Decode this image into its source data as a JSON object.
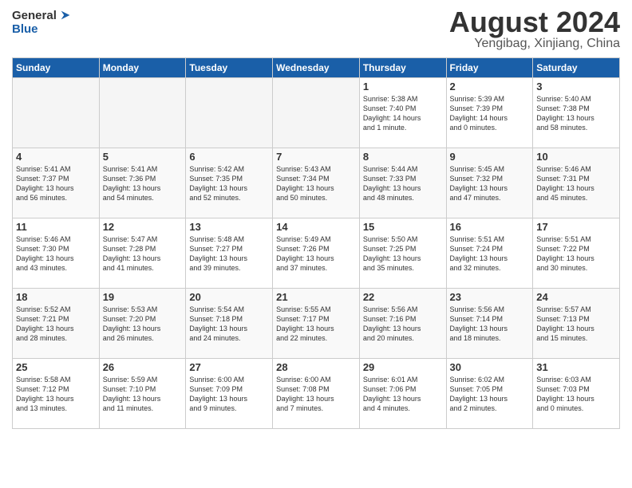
{
  "header": {
    "logo_line1": "General",
    "logo_line2": "Blue",
    "month_title": "August 2024",
    "location": "Yengibag, Xinjiang, China"
  },
  "weekdays": [
    "Sunday",
    "Monday",
    "Tuesday",
    "Wednesday",
    "Thursday",
    "Friday",
    "Saturday"
  ],
  "weeks": [
    [
      {
        "day": "",
        "info": ""
      },
      {
        "day": "",
        "info": ""
      },
      {
        "day": "",
        "info": ""
      },
      {
        "day": "",
        "info": ""
      },
      {
        "day": "1",
        "info": "Sunrise: 5:38 AM\nSunset: 7:40 PM\nDaylight: 14 hours\nand 1 minute."
      },
      {
        "day": "2",
        "info": "Sunrise: 5:39 AM\nSunset: 7:39 PM\nDaylight: 14 hours\nand 0 minutes."
      },
      {
        "day": "3",
        "info": "Sunrise: 5:40 AM\nSunset: 7:38 PM\nDaylight: 13 hours\nand 58 minutes."
      }
    ],
    [
      {
        "day": "4",
        "info": "Sunrise: 5:41 AM\nSunset: 7:37 PM\nDaylight: 13 hours\nand 56 minutes."
      },
      {
        "day": "5",
        "info": "Sunrise: 5:41 AM\nSunset: 7:36 PM\nDaylight: 13 hours\nand 54 minutes."
      },
      {
        "day": "6",
        "info": "Sunrise: 5:42 AM\nSunset: 7:35 PM\nDaylight: 13 hours\nand 52 minutes."
      },
      {
        "day": "7",
        "info": "Sunrise: 5:43 AM\nSunset: 7:34 PM\nDaylight: 13 hours\nand 50 minutes."
      },
      {
        "day": "8",
        "info": "Sunrise: 5:44 AM\nSunset: 7:33 PM\nDaylight: 13 hours\nand 48 minutes."
      },
      {
        "day": "9",
        "info": "Sunrise: 5:45 AM\nSunset: 7:32 PM\nDaylight: 13 hours\nand 47 minutes."
      },
      {
        "day": "10",
        "info": "Sunrise: 5:46 AM\nSunset: 7:31 PM\nDaylight: 13 hours\nand 45 minutes."
      }
    ],
    [
      {
        "day": "11",
        "info": "Sunrise: 5:46 AM\nSunset: 7:30 PM\nDaylight: 13 hours\nand 43 minutes."
      },
      {
        "day": "12",
        "info": "Sunrise: 5:47 AM\nSunset: 7:28 PM\nDaylight: 13 hours\nand 41 minutes."
      },
      {
        "day": "13",
        "info": "Sunrise: 5:48 AM\nSunset: 7:27 PM\nDaylight: 13 hours\nand 39 minutes."
      },
      {
        "day": "14",
        "info": "Sunrise: 5:49 AM\nSunset: 7:26 PM\nDaylight: 13 hours\nand 37 minutes."
      },
      {
        "day": "15",
        "info": "Sunrise: 5:50 AM\nSunset: 7:25 PM\nDaylight: 13 hours\nand 35 minutes."
      },
      {
        "day": "16",
        "info": "Sunrise: 5:51 AM\nSunset: 7:24 PM\nDaylight: 13 hours\nand 32 minutes."
      },
      {
        "day": "17",
        "info": "Sunrise: 5:51 AM\nSunset: 7:22 PM\nDaylight: 13 hours\nand 30 minutes."
      }
    ],
    [
      {
        "day": "18",
        "info": "Sunrise: 5:52 AM\nSunset: 7:21 PM\nDaylight: 13 hours\nand 28 minutes."
      },
      {
        "day": "19",
        "info": "Sunrise: 5:53 AM\nSunset: 7:20 PM\nDaylight: 13 hours\nand 26 minutes."
      },
      {
        "day": "20",
        "info": "Sunrise: 5:54 AM\nSunset: 7:18 PM\nDaylight: 13 hours\nand 24 minutes."
      },
      {
        "day": "21",
        "info": "Sunrise: 5:55 AM\nSunset: 7:17 PM\nDaylight: 13 hours\nand 22 minutes."
      },
      {
        "day": "22",
        "info": "Sunrise: 5:56 AM\nSunset: 7:16 PM\nDaylight: 13 hours\nand 20 minutes."
      },
      {
        "day": "23",
        "info": "Sunrise: 5:56 AM\nSunset: 7:14 PM\nDaylight: 13 hours\nand 18 minutes."
      },
      {
        "day": "24",
        "info": "Sunrise: 5:57 AM\nSunset: 7:13 PM\nDaylight: 13 hours\nand 15 minutes."
      }
    ],
    [
      {
        "day": "25",
        "info": "Sunrise: 5:58 AM\nSunset: 7:12 PM\nDaylight: 13 hours\nand 13 minutes."
      },
      {
        "day": "26",
        "info": "Sunrise: 5:59 AM\nSunset: 7:10 PM\nDaylight: 13 hours\nand 11 minutes."
      },
      {
        "day": "27",
        "info": "Sunrise: 6:00 AM\nSunset: 7:09 PM\nDaylight: 13 hours\nand 9 minutes."
      },
      {
        "day": "28",
        "info": "Sunrise: 6:00 AM\nSunset: 7:08 PM\nDaylight: 13 hours\nand 7 minutes."
      },
      {
        "day": "29",
        "info": "Sunrise: 6:01 AM\nSunset: 7:06 PM\nDaylight: 13 hours\nand 4 minutes."
      },
      {
        "day": "30",
        "info": "Sunrise: 6:02 AM\nSunset: 7:05 PM\nDaylight: 13 hours\nand 2 minutes."
      },
      {
        "day": "31",
        "info": "Sunrise: 6:03 AM\nSunset: 7:03 PM\nDaylight: 13 hours\nand 0 minutes."
      }
    ]
  ]
}
